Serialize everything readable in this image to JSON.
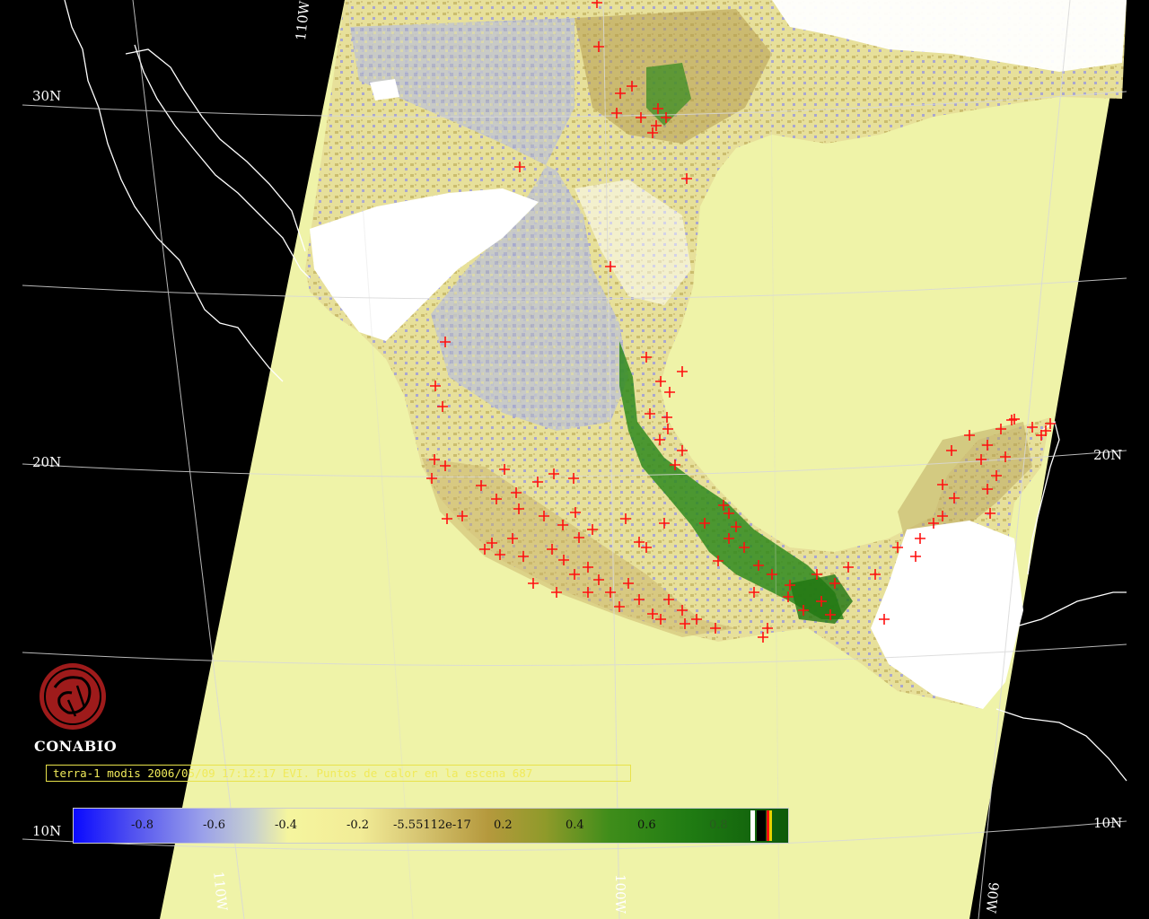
{
  "map": {
    "grid_labels": {
      "lat_30": "30N",
      "lat_20_left": "20N",
      "lat_20_right": "20N",
      "lat_10_left": "10N",
      "lat_10_right": "10N",
      "lon_110_top": "110W",
      "lon_110_bottom": "110W",
      "lon_100_bottom": "100W",
      "lon_90_bottom": "90W"
    },
    "colors": {
      "background": "#000000",
      "swath_base": "#eff3a8",
      "coastline": "#ffffff",
      "gridline": "#d8d8d8",
      "hotspot_marker": "#ff1010",
      "cloud_mask": "#ffffff"
    },
    "hotspot_icon": "plus-marker"
  },
  "logo": {
    "name": "CONABIO",
    "icon": "conabio-seal-icon",
    "color": "#9e1b1b"
  },
  "caption": {
    "text": "terra-1 modis 2006/05/09 17:12:17 EVI. Puntos de calor en la escena 687"
  },
  "colorbar": {
    "ticks": [
      "-0.8",
      "-0.6",
      "-0.4",
      "-0.2",
      "-5.55112e-17",
      "0.2",
      "0.4",
      "0.6",
      "0.8"
    ],
    "extra_classes": [
      {
        "name": "clouds",
        "color": "#ffffff"
      },
      {
        "name": "nodata",
        "color": "#000000"
      },
      {
        "name": "hotspot",
        "color": "#ff1010"
      },
      {
        "name": "flag",
        "color": "#e8d000"
      }
    ]
  }
}
